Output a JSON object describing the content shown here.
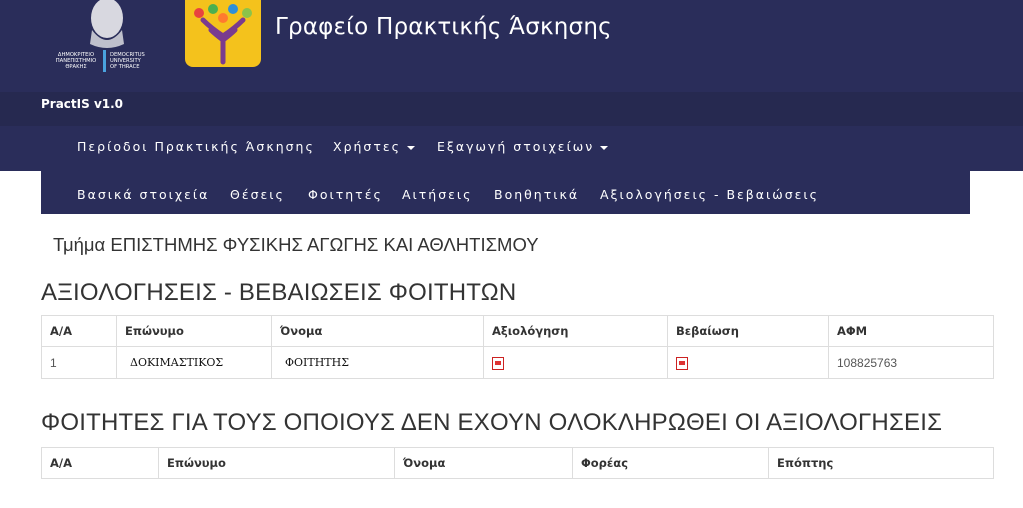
{
  "header": {
    "title": "Γραφείο Πρακτικής Άσκησης",
    "univ_logo_text": [
      "ΔΗΜΟΚΡΙΤΕΙΟ ΠΑΝΕΠΙΣΤΗΜΙΟ ΘΡΑΚΗΣ",
      "DEMOCRITUS UNIVERSITY OF THRACE"
    ],
    "brand": "PractIS v1.0"
  },
  "main_nav": {
    "periods": "Περίοδοι Πρακτικής Άσκησης",
    "users": "Χρήστες",
    "export": "Εξαγωγή στοιχείων"
  },
  "sub_nav": {
    "basic": "Βασικά στοιχεία",
    "positions": "Θέσεις",
    "students": "Φοιτητές",
    "applications": "Αιτήσεις",
    "auxiliary": "Βοηθητικά",
    "evaluations": "Αξιολογήσεις - Βεβαιώσεις"
  },
  "page": {
    "department": "Τμήμα ΕΠΙΣΤΗΜΗΣ ΦΥΣΙΚΗΣ ΑΓΩΓΗΣ ΚΑΙ ΑΘΛΗΤΙΣΜΟΥ",
    "section1_title": "ΑΞΙΟΛΟΓΗΣΕΙΣ - ΒΕΒΑΙΩΣΕΙΣ ΦΟΙΤΗΤΩΝ",
    "section2_title": "ΦΟΙΤΗΤΕΣ ΓΙΑ ΤΟΥΣ ΟΠΟΙΟΥΣ ΔΕΝ ΕΧΟΥΝ ΟΛΟΚΛΗΡΩΘΕΙ ΟΙ ΑΞΙΟΛΟΓΗΣΕΙΣ"
  },
  "table1": {
    "headers": [
      "Α/Α",
      "Επώνυμο",
      "Όνομα",
      "Αξιολόγηση",
      "Βεβαίωση",
      "ΑΦΜ"
    ],
    "rows": [
      {
        "aa": "1",
        "surname": "ΔΟΚΙΜΑΣΤΙΚΟΣ",
        "name": "ΦΟΙΤΗΤΗΣ",
        "evaluation_icon": "pdf-icon",
        "certificate_icon": "pdf-icon",
        "afm": "108825763"
      }
    ]
  },
  "table2": {
    "headers": [
      "Α/Α",
      "Επώνυμο",
      "Όνομα",
      "Φορέας",
      "Επόπτης"
    ]
  },
  "colors": {
    "header_bg": "#2a2d5a",
    "app_logo_bg": "#f4c21c"
  }
}
